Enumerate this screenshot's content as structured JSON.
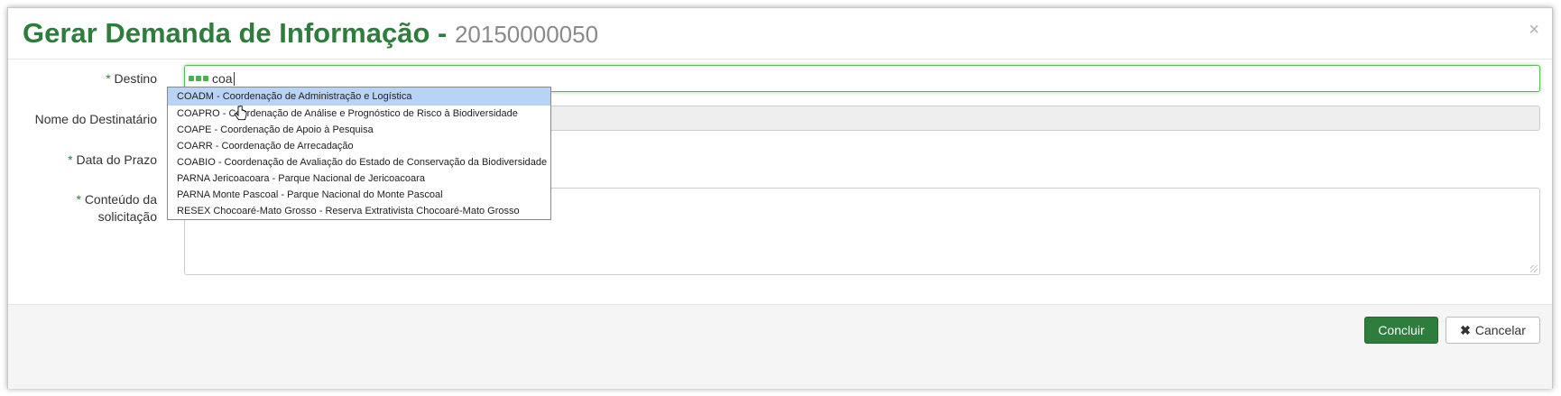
{
  "modal": {
    "title": "Gerar Demanda de Informação",
    "title_separator": "-",
    "demand_number": "20150000050",
    "close_icon": "close-icon"
  },
  "form": {
    "required_marker": "*",
    "destino": {
      "label": "Destino",
      "value": "coa"
    },
    "nome_destinatario": {
      "label": "Nome do Destinatário",
      "value": ""
    },
    "data_prazo": {
      "label": "Data do Prazo",
      "value": ""
    },
    "conteudo": {
      "label_line1": "Conteúdo da",
      "label_line2": "solicitação",
      "value": ""
    }
  },
  "autocomplete": {
    "highlighted_index": 0,
    "items": [
      "COADM - Coordenação de Administração e Logística",
      "COAPRO - Coordenação de Análise e Prognóstico de Risco à Biodiversidade",
      "COAPE - Coordenação de Apoio à Pesquisa",
      "COARR - Coordenação de Arrecadação",
      "COABIO - Coordenação de Avaliação do Estado de Conservação da Biodiversidade",
      "PARNA Jericoacoara - Parque Nacional de Jericoacoara",
      "PARNA Monte Pascoal - Parque Nacional do Monte Pascoal",
      "RESEX Chocoaré-Mato Grosso - Reserva Extrativista Chocoaré-Mato Grosso"
    ]
  },
  "footer": {
    "submit_label": "Concluir",
    "cancel_label": "Cancelar",
    "cancel_icon": "times-icon"
  },
  "colors": {
    "primary_green": "#2e7d3c",
    "highlight_blue": "#b8d3f5",
    "number_gray": "#8a8a8a"
  }
}
